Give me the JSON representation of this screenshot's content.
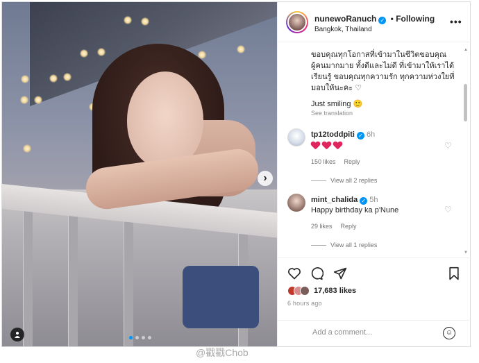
{
  "post": {
    "username": "nunewoRanuch",
    "follow_label": "Following",
    "location": "Bangkok, Thailand",
    "more_glyph": "•••",
    "carousel_next_glyph": "›",
    "tag_glyph": "👤",
    "caption": "ขอบคุณทุกโอกาสที่เข้ามาในชีวิตขอบคุณผู้คนมากมาย ทั้งดีและไม่ดี ที่เข้ามาให้เราได้เรียนรู้ ขอบคุณทุกความรัก ทุกความห่วงใยที่มอบให้นะคะ ♡",
    "caption_2": "Just smiling 🙂",
    "see_translation": "See translation"
  },
  "comments": [
    {
      "user": "tp12toddpiti",
      "time": "6h",
      "text": "❤️❤️❤️",
      "likes": "150 likes",
      "reply": "Reply",
      "view_replies": "View all 2 replies",
      "avatar_icon": "avatar-icon"
    },
    {
      "user": "mint_chalida",
      "time": "5h",
      "text": "Happy birthday ka p'Nune",
      "likes": "29 likes",
      "reply": "Reply",
      "view_replies": "View all 1 replies",
      "avatar_icon": "avatar-icon"
    }
  ],
  "actions": {
    "like_icon": "heart-outline-icon",
    "comment_icon": "comment-icon",
    "share_icon": "send-icon",
    "save_icon": "bookmark-icon",
    "likes_count": "17,683 likes",
    "time_ago": "6 hours ago",
    "comment_placeholder": "Add a comment...",
    "emoji_icon": "emoji-icon"
  },
  "watermark": "@戳戳Chob",
  "colors": {
    "verified": "#0095f6",
    "heart": "#e0245e",
    "text": "#262626",
    "muted": "#8e8e8e"
  }
}
